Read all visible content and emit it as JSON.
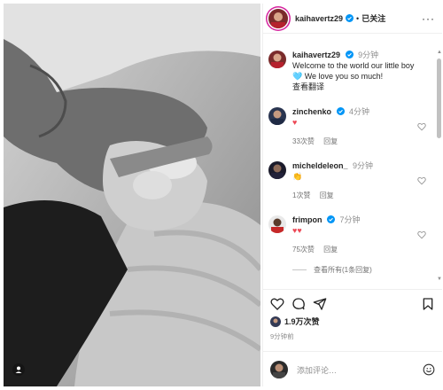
{
  "post": {
    "author": "kaihavertz29",
    "follow_state": "已关注",
    "caption_time": "9分钟",
    "caption_line1": "Welcome to the world our little boy",
    "caption_line2": "🩵 We love you so much!",
    "translate": "查看翻译",
    "likes": "1.9万次赞",
    "posted_ago": "9分钟前",
    "add_comment_placeholder": "添加评论…"
  },
  "comments": [
    {
      "user": "zinchenko",
      "time": "4分钟",
      "text": "♥",
      "likes": "33次赞",
      "reply": "回复",
      "verified": true
    },
    {
      "user": "micheldeleon_",
      "time": "9分钟",
      "text": "👏",
      "likes": "1次赞",
      "reply": "回复",
      "verified": false
    },
    {
      "user": "frimpon",
      "time": "7分钟",
      "text": "♥♥",
      "likes": "75次赞",
      "reply": "回复",
      "verified": true
    }
  ],
  "view_replies": "查看所有(1条回复)",
  "icons": {
    "like": "heart-icon",
    "comment": "comment-icon",
    "share": "share-icon",
    "save": "bookmark-icon",
    "more": "more-options-icon",
    "emoji": "emoji-icon",
    "verified": "verified-badge-icon",
    "tag": "user-tag-icon"
  },
  "colors": {
    "accent": "#0095f6",
    "heart": "#ed4956",
    "story_ring": "#d6249f"
  }
}
